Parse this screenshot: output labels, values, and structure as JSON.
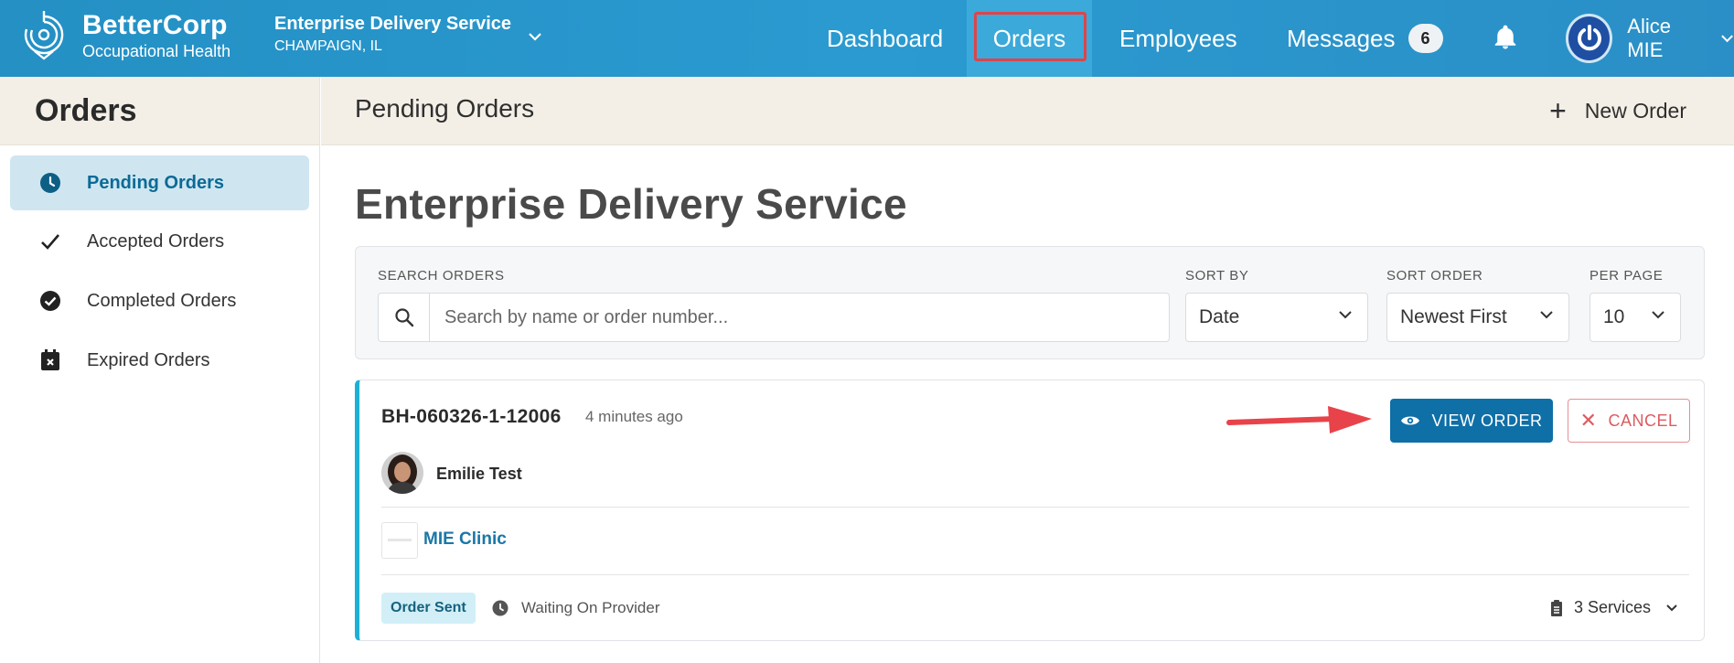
{
  "header": {
    "brand_name": "BetterCorp",
    "brand_sub": "Occupational Health",
    "company_name": "Enterprise Delivery Service",
    "company_location": "CHAMPAIGN, IL",
    "nav": {
      "dashboard": "Dashboard",
      "orders": "Orders",
      "employees": "Employees",
      "messages": "Messages",
      "messages_count": "6"
    },
    "user_name": "Alice MIE"
  },
  "sidebar": {
    "title": "Orders",
    "items": [
      {
        "label": "Pending Orders",
        "icon": "clock-icon",
        "active": true
      },
      {
        "label": "Accepted Orders",
        "icon": "check-icon",
        "active": false
      },
      {
        "label": "Completed Orders",
        "icon": "check-circle-icon",
        "active": false
      },
      {
        "label": "Expired Orders",
        "icon": "calendar-x-icon",
        "active": false
      }
    ]
  },
  "main": {
    "header_title": "Pending Orders",
    "new_order_label": "New Order",
    "page_title": "Enterprise Delivery Service"
  },
  "filters": {
    "search_label": "SEARCH ORDERS",
    "search_placeholder": "Search by name or order number...",
    "sort_by_label": "SORT BY",
    "sort_by_value": "Date",
    "sort_order_label": "SORT ORDER",
    "sort_order_value": "Newest First",
    "per_page_label": "PER PAGE",
    "per_page_value": "10"
  },
  "order": {
    "number": "BH-060326-1-12006",
    "time_ago": "4 minutes ago",
    "view_label": "VIEW ORDER",
    "cancel_label": "CANCEL",
    "person_name": "Emilie Test",
    "clinic_name": "MIE Clinic",
    "status": "Order Sent",
    "waiting": "Waiting On Provider",
    "services": "3 Services"
  },
  "colors": {
    "topbar": "#2a9ad0",
    "primary_button": "#0f6fa7",
    "cancel": "#dc5b60",
    "highlight": "#e0434a",
    "card_accent": "#1bb1d6"
  }
}
